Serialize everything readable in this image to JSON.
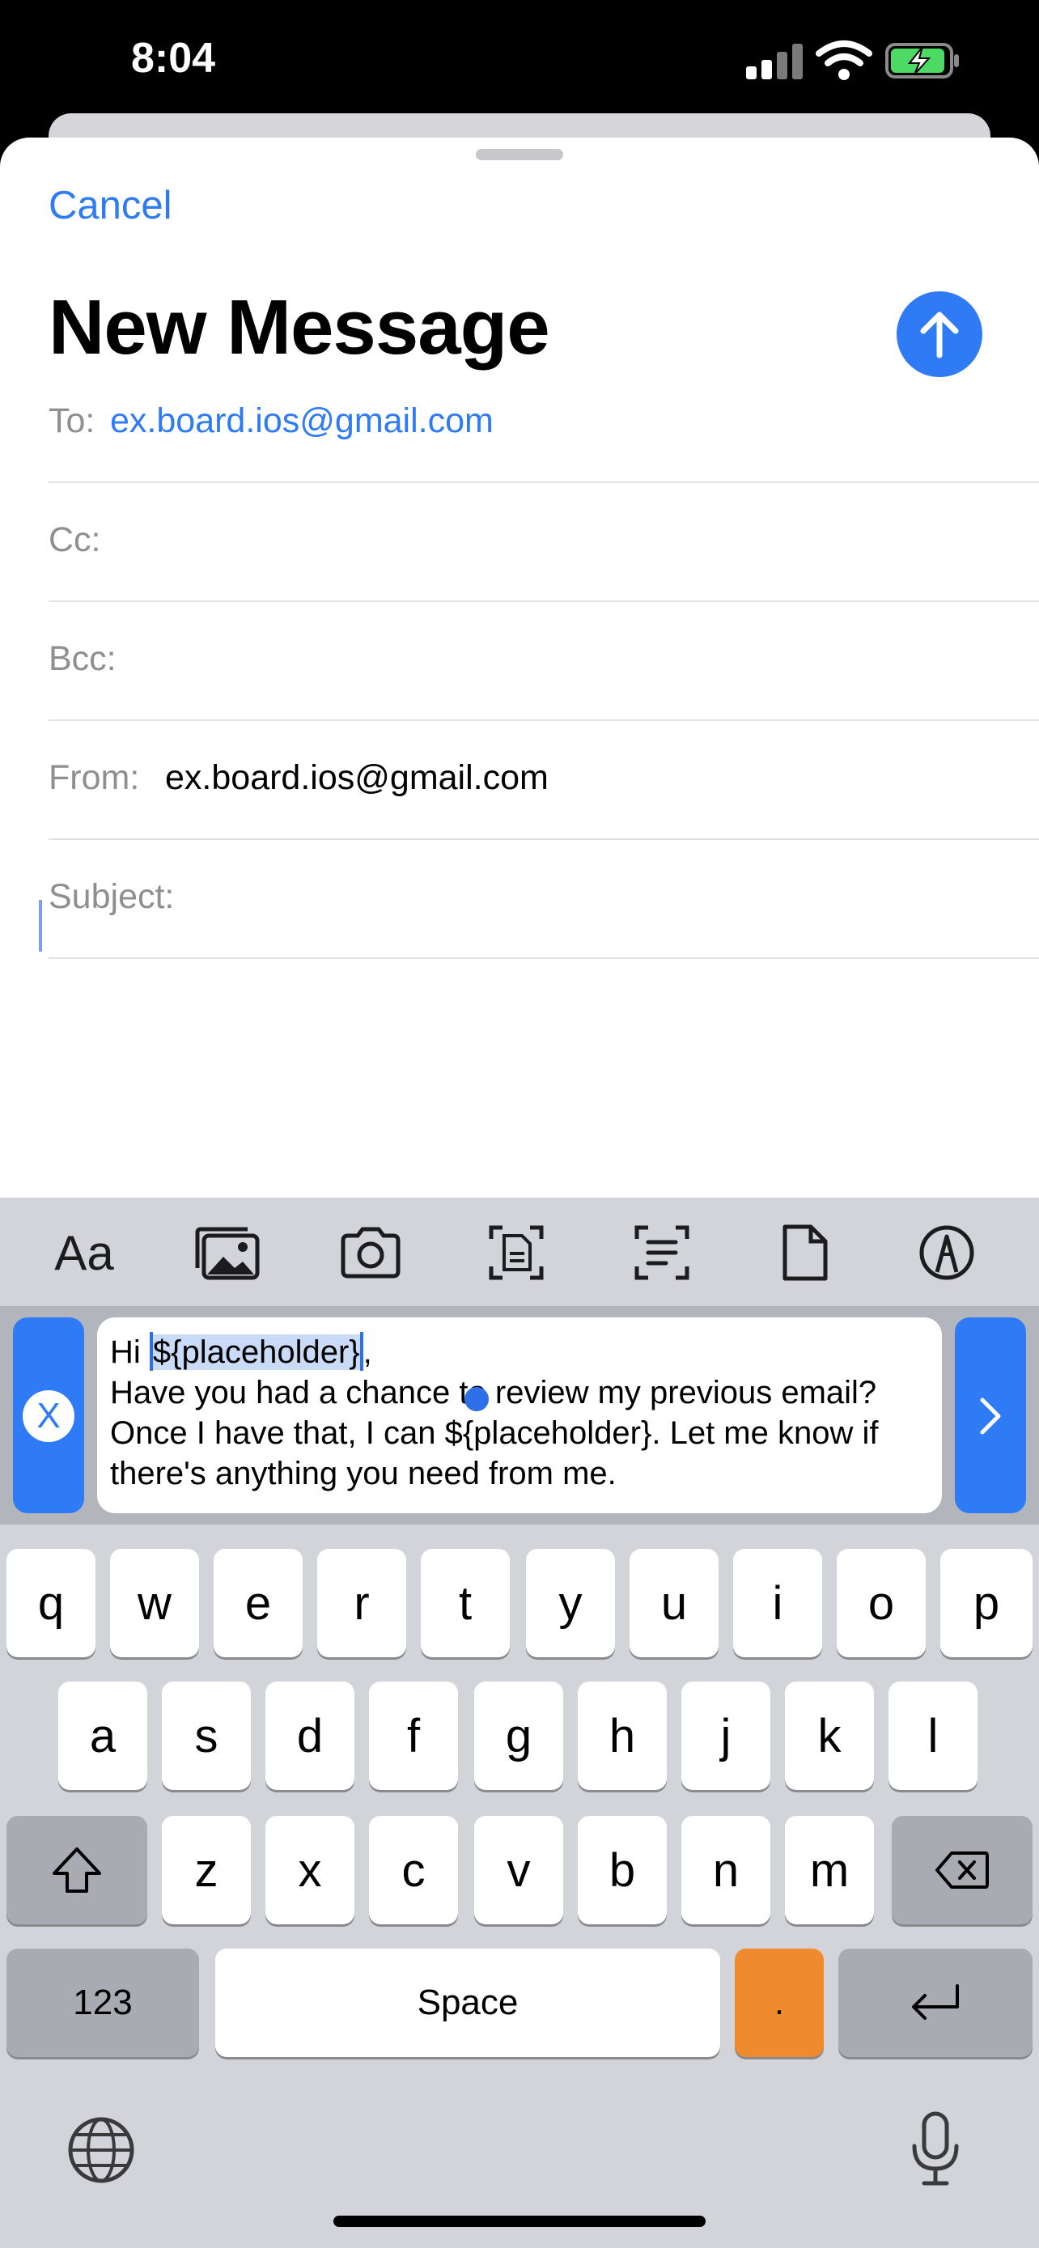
{
  "status": {
    "time": "8:04"
  },
  "sheet": {
    "cancel_label": "Cancel",
    "title": "New Message"
  },
  "fields": {
    "to_label": "To:",
    "to_value": "ex.board.ios@gmail.com",
    "cc_label": "Cc:",
    "bcc_label": "Bcc:",
    "from_label": "From:",
    "from_value": "ex.board.ios@gmail.com",
    "subject_label": "Subject:"
  },
  "toolbar": {
    "format_label": "Aa"
  },
  "snippet": {
    "close_label": "X",
    "greeting": "Hi ",
    "selected_placeholder": "${placeholder}",
    "after_selection": ",",
    "body": "Have you had a chance to review my previous email?\nOnce I have that, I can ${placeholder}. Let me know if there's anything you need from me."
  },
  "keyboard": {
    "row1": [
      "q",
      "w",
      "e",
      "r",
      "t",
      "y",
      "u",
      "i",
      "o",
      "p"
    ],
    "row2": [
      "a",
      "s",
      "d",
      "f",
      "g",
      "h",
      "j",
      "k",
      "l"
    ],
    "row3": [
      "z",
      "x",
      "c",
      "v",
      "b",
      "n",
      "m"
    ],
    "numbers_label": "123",
    "space_label": "Space",
    "period_label": "."
  },
  "colors": {
    "accent": "#2f7bf5",
    "keyboard_bg": "#d3d4d9",
    "period_key": "#f08a2e"
  }
}
